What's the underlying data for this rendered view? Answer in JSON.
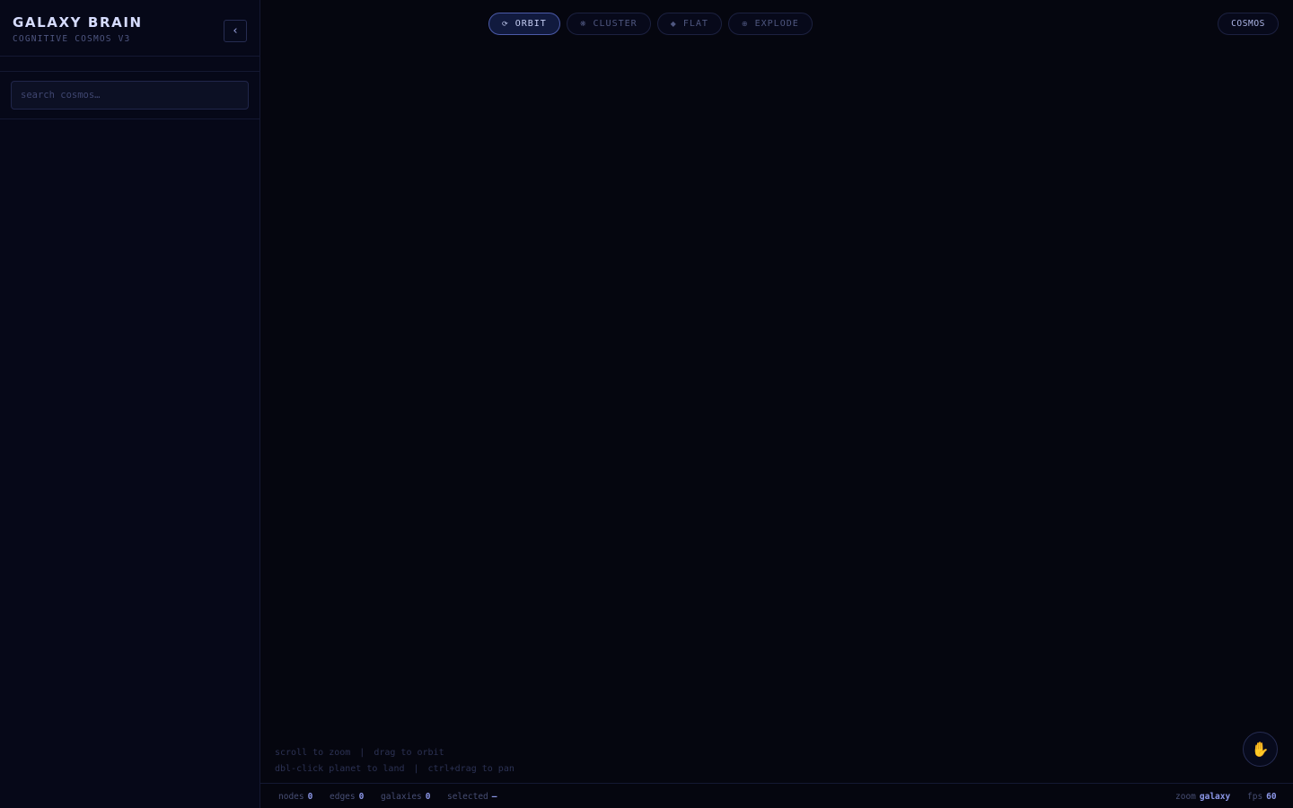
{
  "sidebar": {
    "brand_title": "GALAXY BRAIN",
    "brand_subtitle": "COGNITIVE COSMOS V3",
    "collapse_icon": "chevron-left-icon",
    "search": {
      "value": "",
      "placeholder": "search cosmos…"
    }
  },
  "modes": [
    {
      "label": "ORBIT",
      "icon": "orbit-icon",
      "glyph": "⟳",
      "active": true
    },
    {
      "label": "CLUSTER",
      "icon": "cluster-icon",
      "glyph": "❋",
      "active": false
    },
    {
      "label": "FLAT",
      "icon": "diamond-icon",
      "glyph": "◆",
      "active": false
    },
    {
      "label": "EXPLODE",
      "icon": "explode-icon",
      "glyph": "⊕",
      "active": false
    }
  ],
  "view_button": {
    "label": "COSMOS"
  },
  "hints": {
    "line1_a": "scroll to zoom",
    "line1_b": "drag to orbit",
    "line2_a": "dbl-click planet to land",
    "line2_b": "ctrl+drag to pan",
    "separator": "|"
  },
  "hand_button": {
    "icon": "hand-icon",
    "glyph": "✋"
  },
  "status": {
    "nodes_label": "nodes",
    "nodes_value": "0",
    "edges_label": "edges",
    "edges_value": "0",
    "galaxies_label": "galaxies",
    "galaxies_value": "0",
    "selected_label": "selected",
    "selected_value": "—",
    "zoom_label": "zoom",
    "zoom_value": "galaxy",
    "fps_label": "fps",
    "fps_value": "60"
  },
  "colors": {
    "background": "#05060f",
    "accent": "#8c97e8",
    "active_mode_border": "#4b5aa8",
    "hand_icon": "#f2b530"
  }
}
